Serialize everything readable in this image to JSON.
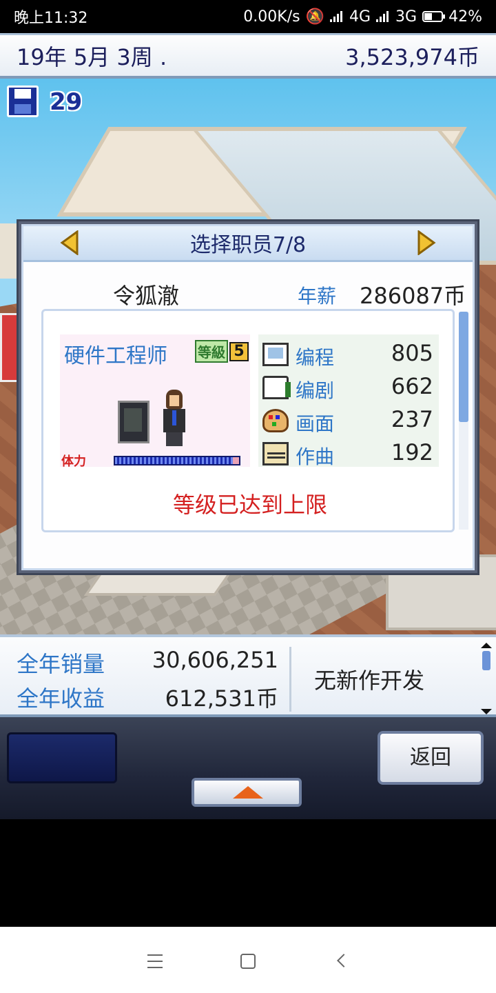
{
  "status_bar": {
    "time": "晚上11:32",
    "net_speed": "0.00K/s",
    "network_1": "4G",
    "network_2": "3G",
    "battery": "42%"
  },
  "top_bar": {
    "date": "19年 5月 3周 .",
    "money": "3,523,974币"
  },
  "scene": {
    "save_count": "29"
  },
  "dialog": {
    "title": "选择职员7/8",
    "employee_name": "令狐澈",
    "salary_label": "年薪",
    "salary_value": "286087币",
    "job_title": "硬件工程师",
    "level_tag": "等級",
    "level_value": "5",
    "hp_label": "体力",
    "hp_fraction": 0.95,
    "stats": [
      {
        "label": "编程",
        "value": "805",
        "icon": "computer-icon"
      },
      {
        "label": "编剧",
        "value": "662",
        "icon": "book-icon"
      },
      {
        "label": "画面",
        "value": "237",
        "icon": "palette-icon"
      },
      {
        "label": "作曲",
        "value": "192",
        "icon": "note-icon"
      }
    ],
    "limit_message": "等级已达到上限"
  },
  "info": {
    "annual_sales_label": "全年销量",
    "annual_sales_value": "30,606,251",
    "annual_revenue_label": "全年收益",
    "annual_revenue_value": "612,531币",
    "dev_status": "无新作开发"
  },
  "controls": {
    "back_label": "返回"
  },
  "colors": {
    "accent_blue": "#2e76c7",
    "warning_red": "#d42020",
    "dark_navy": "#1c1f5c"
  }
}
